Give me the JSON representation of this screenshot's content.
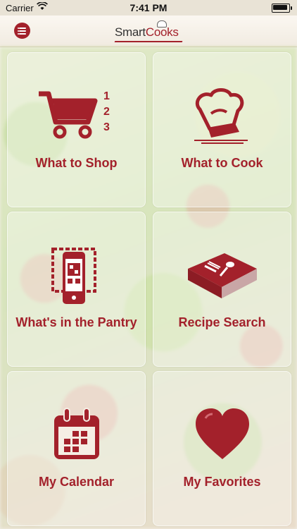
{
  "status_bar": {
    "carrier": "Carrier",
    "time": "7:41 PM"
  },
  "header": {
    "logo_text_a": "Smart",
    "logo_text_b": "Cooks",
    "menu_icon": "list-icon"
  },
  "tiles": [
    {
      "label": "What to Shop",
      "icon": "shopping-cart-icon"
    },
    {
      "label": "What to Cook",
      "icon": "chef-hat-icon"
    },
    {
      "label": "What's in the Pantry",
      "icon": "qr-phone-icon"
    },
    {
      "label": "Recipe Search",
      "icon": "cookbook-icon"
    },
    {
      "label": "My Calendar",
      "icon": "calendar-icon"
    },
    {
      "label": "My Favorites",
      "icon": "heart-icon"
    }
  ],
  "cart_numbers": [
    "1",
    "2",
    "3"
  ],
  "colors": {
    "accent": "#a3212b",
    "navbar": "#f6f1e9"
  }
}
